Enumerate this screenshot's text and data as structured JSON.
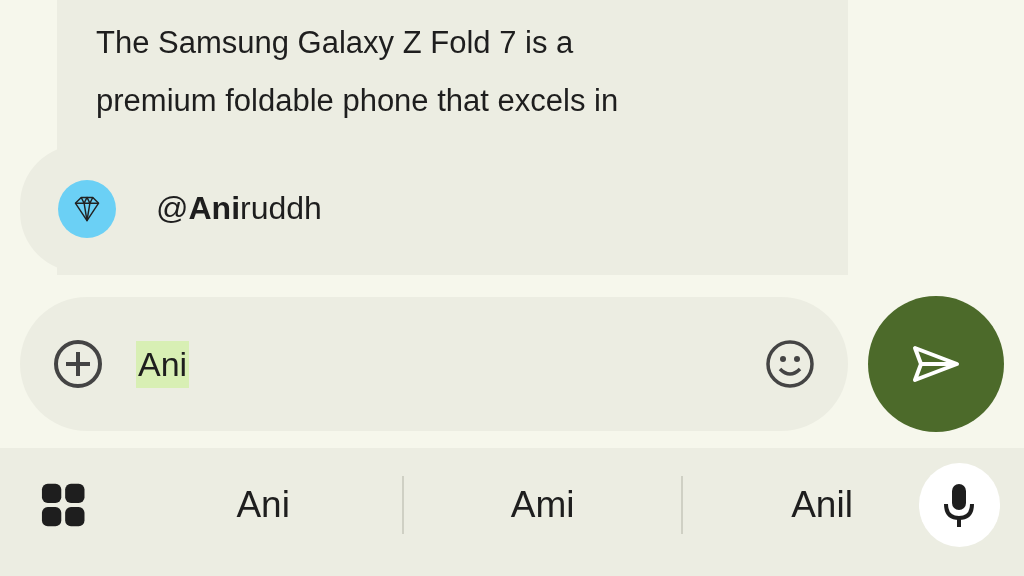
{
  "message": {
    "lines": [
      "The Samsung Galaxy Z Fold 7 is a",
      "premium foldable phone that excels in"
    ]
  },
  "mention_suggestion": {
    "text": "@**Ani**ruddh"
  },
  "composer": {
    "value": "Ani",
    "composing": true
  },
  "keyboard": {
    "suggestions": [
      "Ani",
      "Ami",
      "Anil"
    ]
  }
}
